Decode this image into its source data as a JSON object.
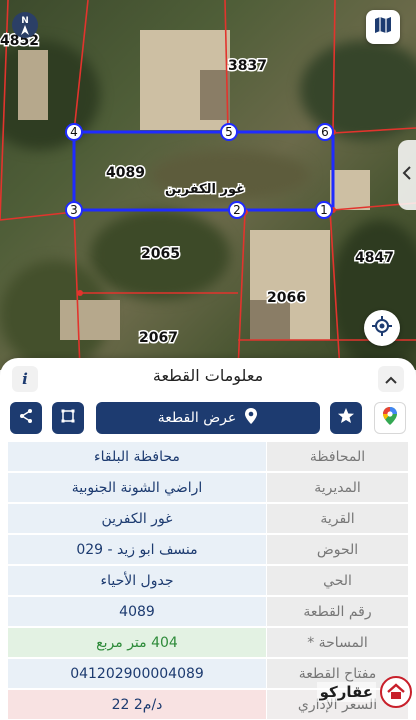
{
  "map": {
    "parcel_labels": [
      "3837",
      "4089",
      "2065",
      "4847",
      "2066",
      "2067",
      "4852"
    ],
    "selected_parcel_name": "غور الكفرين",
    "vertex_labels": [
      "1",
      "2",
      "3",
      "4",
      "5",
      "6"
    ],
    "colors": {
      "selected_outline": "#1f2bff",
      "parcel_lines": "#e2342d",
      "vertex_fill": "#ffffff"
    }
  },
  "sheet": {
    "title": "معلومات القطعة",
    "info_label": "i",
    "actions": {
      "show_parcel_label": "عرض القطعة",
      "watermark": "www.aqarkajo.com"
    },
    "rows": [
      {
        "label": "المحافظة",
        "value": "محافظة البلقاء"
      },
      {
        "label": "المديرية",
        "value": "اراضي الشونة الجنوبية"
      },
      {
        "label": "القرية",
        "value": "غور الكفرين"
      },
      {
        "label": "الحوض",
        "value": "منسف ابو زيد - 029"
      },
      {
        "label": "الحي",
        "value": "جدول الأحياء"
      },
      {
        "label": "رقم القطعة",
        "value": "4089"
      },
      {
        "label": "المساحة *",
        "value": "404   متر مربع"
      },
      {
        "label": "مفتاح القطعة",
        "value": "041202900004089"
      },
      {
        "label": "السعر الإداري",
        "value": "22 د/م2"
      }
    ],
    "logo_text": "عقاركو"
  },
  "colors": {
    "accent": "#1d3b70",
    "green_text": "#2e8b3a",
    "row_value_bg": "#e9f0f7",
    "row_label_bg": "#ececec"
  },
  "icons": [
    "north-arrow-icon",
    "map-layers-icon",
    "chevron-left-icon",
    "locate-icon",
    "info-icon",
    "chevron-up-icon",
    "share-icon",
    "polygon-icon",
    "location-pin-icon",
    "star-icon",
    "google-maps-icon"
  ]
}
